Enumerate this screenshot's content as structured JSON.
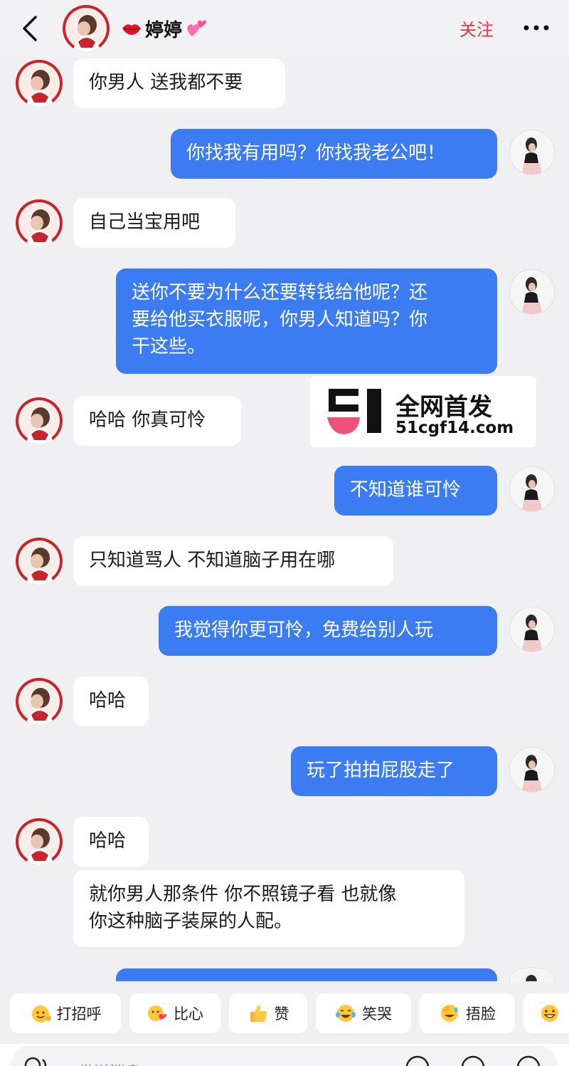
{
  "header": {
    "contact_name": "婷婷",
    "name_prefix_icon": "lips-icon",
    "name_suffix_icon": "two-hearts-icon",
    "follow_label": "关注",
    "accent_color": "#e8334b"
  },
  "messages": [
    {
      "side": "in",
      "lines": [
        "你男人 送我都不要"
      ]
    },
    {
      "side": "out",
      "lines": [
        "你找我有用吗？你找我老公吧！"
      ]
    },
    {
      "side": "in",
      "lines": [
        "自己当宝用吧"
      ]
    },
    {
      "side": "out",
      "lines": [
        "送你不要为什么还要转钱给他呢？还",
        "要给他买衣服呢，你男人知道吗？你",
        "干这些。"
      ]
    },
    {
      "side": "in",
      "lines": [
        "哈哈 你真可怜"
      ]
    },
    {
      "side": "out",
      "lines": [
        "不知道谁可怜"
      ]
    },
    {
      "side": "in",
      "lines": [
        "只知道骂人 不知道脑子用在哪"
      ]
    },
    {
      "side": "out",
      "lines": [
        "我觉得你更可怜，免费给别人玩"
      ]
    },
    {
      "side": "in",
      "lines": [
        "哈哈"
      ]
    },
    {
      "side": "out",
      "lines": [
        "玩了拍拍屁股走了"
      ]
    },
    {
      "side": "in",
      "lines": [
        "哈哈"
      ]
    },
    {
      "side": "in",
      "lines": [
        "就你男人那条件 你不照镜子看 也就像",
        "你这种脑子装屎的人配。"
      ]
    }
  ],
  "colors": {
    "outgoing_bubble": "#3b7cf2",
    "incoming_bubble": "#ffffff",
    "background": "#f0f0f2"
  },
  "watermark": {
    "logo_text": "51",
    "line1": "全网首发",
    "line2": "51cgf14.com"
  },
  "quick_replies": [
    {
      "label": "打招呼",
      "icon": "wave-hand-emoji-icon"
    },
    {
      "label": "比心",
      "icon": "heart-hands-emoji-icon"
    },
    {
      "label": "赞",
      "icon": "thumbs-up-emoji-icon"
    },
    {
      "label": "笑哭",
      "icon": "tears-of-joy-emoji-icon"
    },
    {
      "label": "捂脸",
      "icon": "facepalm-emoji-icon"
    },
    {
      "label": "",
      "icon": "grinning-emoji-icon"
    }
  ],
  "input": {
    "placeholder": "发送消息"
  }
}
